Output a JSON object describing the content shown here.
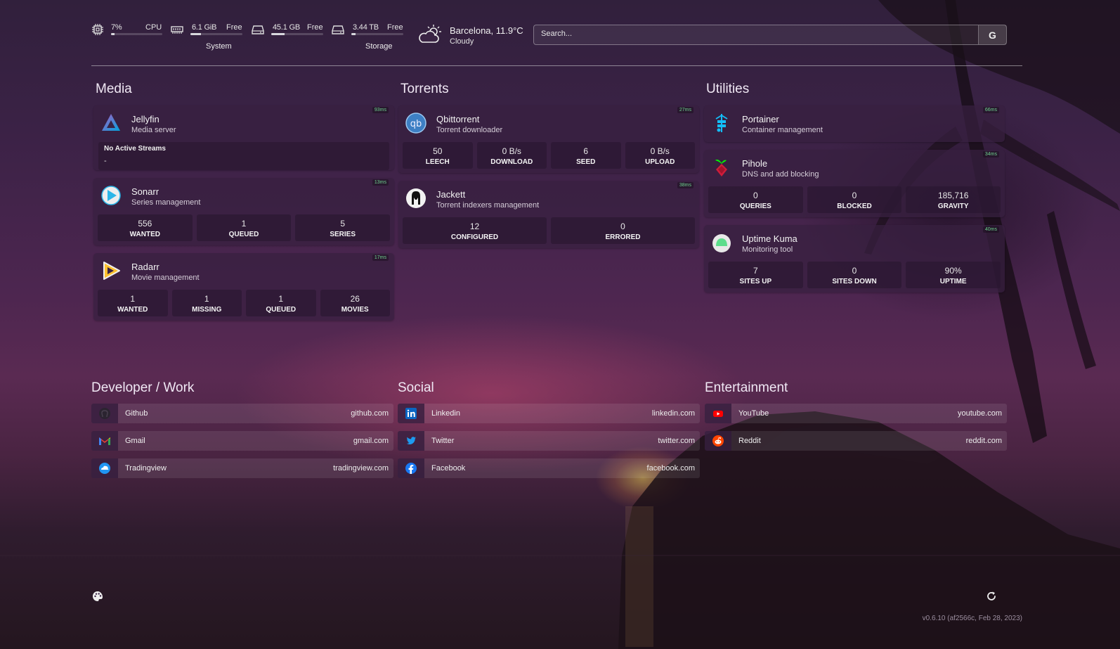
{
  "resources": {
    "group_system": "System",
    "group_storage": "Storage",
    "cpu": {
      "value": "7%",
      "label": "CPU",
      "usage": 0.07
    },
    "memory": {
      "value": "6.1 GiB",
      "label": "Free",
      "usage": 0.2
    },
    "disk1": {
      "value": "45.1 GB",
      "label": "Free",
      "usage": 0.25
    },
    "disk2": {
      "value": "3.44 TB",
      "label": "Free",
      "usage": 0.08
    }
  },
  "weather": {
    "location": "Barcelona, 11.9°C",
    "condition": "Cloudy"
  },
  "search": {
    "placeholder": "Search...",
    "provider_icon": "G"
  },
  "sections": {
    "media": {
      "title": "Media",
      "jellyfin": {
        "name": "Jellyfin",
        "desc": "Media server",
        "ping": "93ms",
        "streams_title": "No Active Streams",
        "streams_value": "-"
      },
      "sonarr": {
        "name": "Sonarr",
        "desc": "Series management",
        "ping": "13ms",
        "stats": [
          {
            "n": "556",
            "k": "WANTED"
          },
          {
            "n": "1",
            "k": "QUEUED"
          },
          {
            "n": "5",
            "k": "SERIES"
          }
        ]
      },
      "radarr": {
        "name": "Radarr",
        "desc": "Movie management",
        "ping": "17ms",
        "stats": [
          {
            "n": "1",
            "k": "WANTED"
          },
          {
            "n": "1",
            "k": "MISSING"
          },
          {
            "n": "1",
            "k": "QUEUED"
          },
          {
            "n": "26",
            "k": "MOVIES"
          }
        ]
      }
    },
    "torrents": {
      "title": "Torrents",
      "qbittorrent": {
        "name": "Qbittorrent",
        "desc": "Torrent downloader",
        "ping": "27ms",
        "stats": [
          {
            "n": "50",
            "k": "LEECH"
          },
          {
            "n": "0 B/s",
            "k": "DOWNLOAD"
          },
          {
            "n": "6",
            "k": "SEED"
          },
          {
            "n": "0 B/s",
            "k": "UPLOAD"
          }
        ]
      },
      "jackett": {
        "name": "Jackett",
        "desc": "Torrent indexers management",
        "ping": "38ms",
        "stats": [
          {
            "n": "12",
            "k": "CONFIGURED"
          },
          {
            "n": "0",
            "k": "ERRORED"
          }
        ]
      }
    },
    "utilities": {
      "title": "Utilities",
      "portainer": {
        "name": "Portainer",
        "desc": "Container management",
        "ping": "66ms"
      },
      "pihole": {
        "name": "Pihole",
        "desc": "DNS and add blocking",
        "ping": "34ms",
        "stats": [
          {
            "n": "0",
            "k": "QUERIES"
          },
          {
            "n": "0",
            "k": "BLOCKED"
          },
          {
            "n": "185,716",
            "k": "GRAVITY"
          }
        ]
      },
      "uptimekuma": {
        "name": "Uptime Kuma",
        "desc": "Monitoring tool",
        "ping": "40ms",
        "stats": [
          {
            "n": "7",
            "k": "SITES UP"
          },
          {
            "n": "0",
            "k": "SITES DOWN"
          },
          {
            "n": "90%",
            "k": "UPTIME"
          }
        ]
      }
    }
  },
  "bookmarks": {
    "developer": {
      "title": "Developer / Work",
      "items": [
        {
          "name": "Github",
          "url": "github.com",
          "icon": "github-icon"
        },
        {
          "name": "Gmail",
          "url": "gmail.com",
          "icon": "gmail-icon"
        },
        {
          "name": "Tradingview",
          "url": "tradingview.com",
          "icon": "tradingview-icon"
        }
      ]
    },
    "social": {
      "title": "Social",
      "items": [
        {
          "name": "Linkedin",
          "url": "linkedin.com",
          "icon": "linkedin-icon"
        },
        {
          "name": "Twitter",
          "url": "twitter.com",
          "icon": "twitter-icon"
        },
        {
          "name": "Facebook",
          "url": "facebook.com",
          "icon": "facebook-icon"
        }
      ]
    },
    "entertainment": {
      "title": "Entertainment",
      "items": [
        {
          "name": "YouTube",
          "url": "youtube.com",
          "icon": "youtube-icon"
        },
        {
          "name": "Reddit",
          "url": "reddit.com",
          "icon": "reddit-icon"
        }
      ]
    }
  },
  "footer": {
    "version": "v0.6.10 (af2566c, Feb 28, 2023)",
    "left_icon": "palette-icon",
    "right_icon": "refresh-icon"
  },
  "colors": {
    "ping": "#6fd38f",
    "accent_text": "#f0e8f4"
  }
}
